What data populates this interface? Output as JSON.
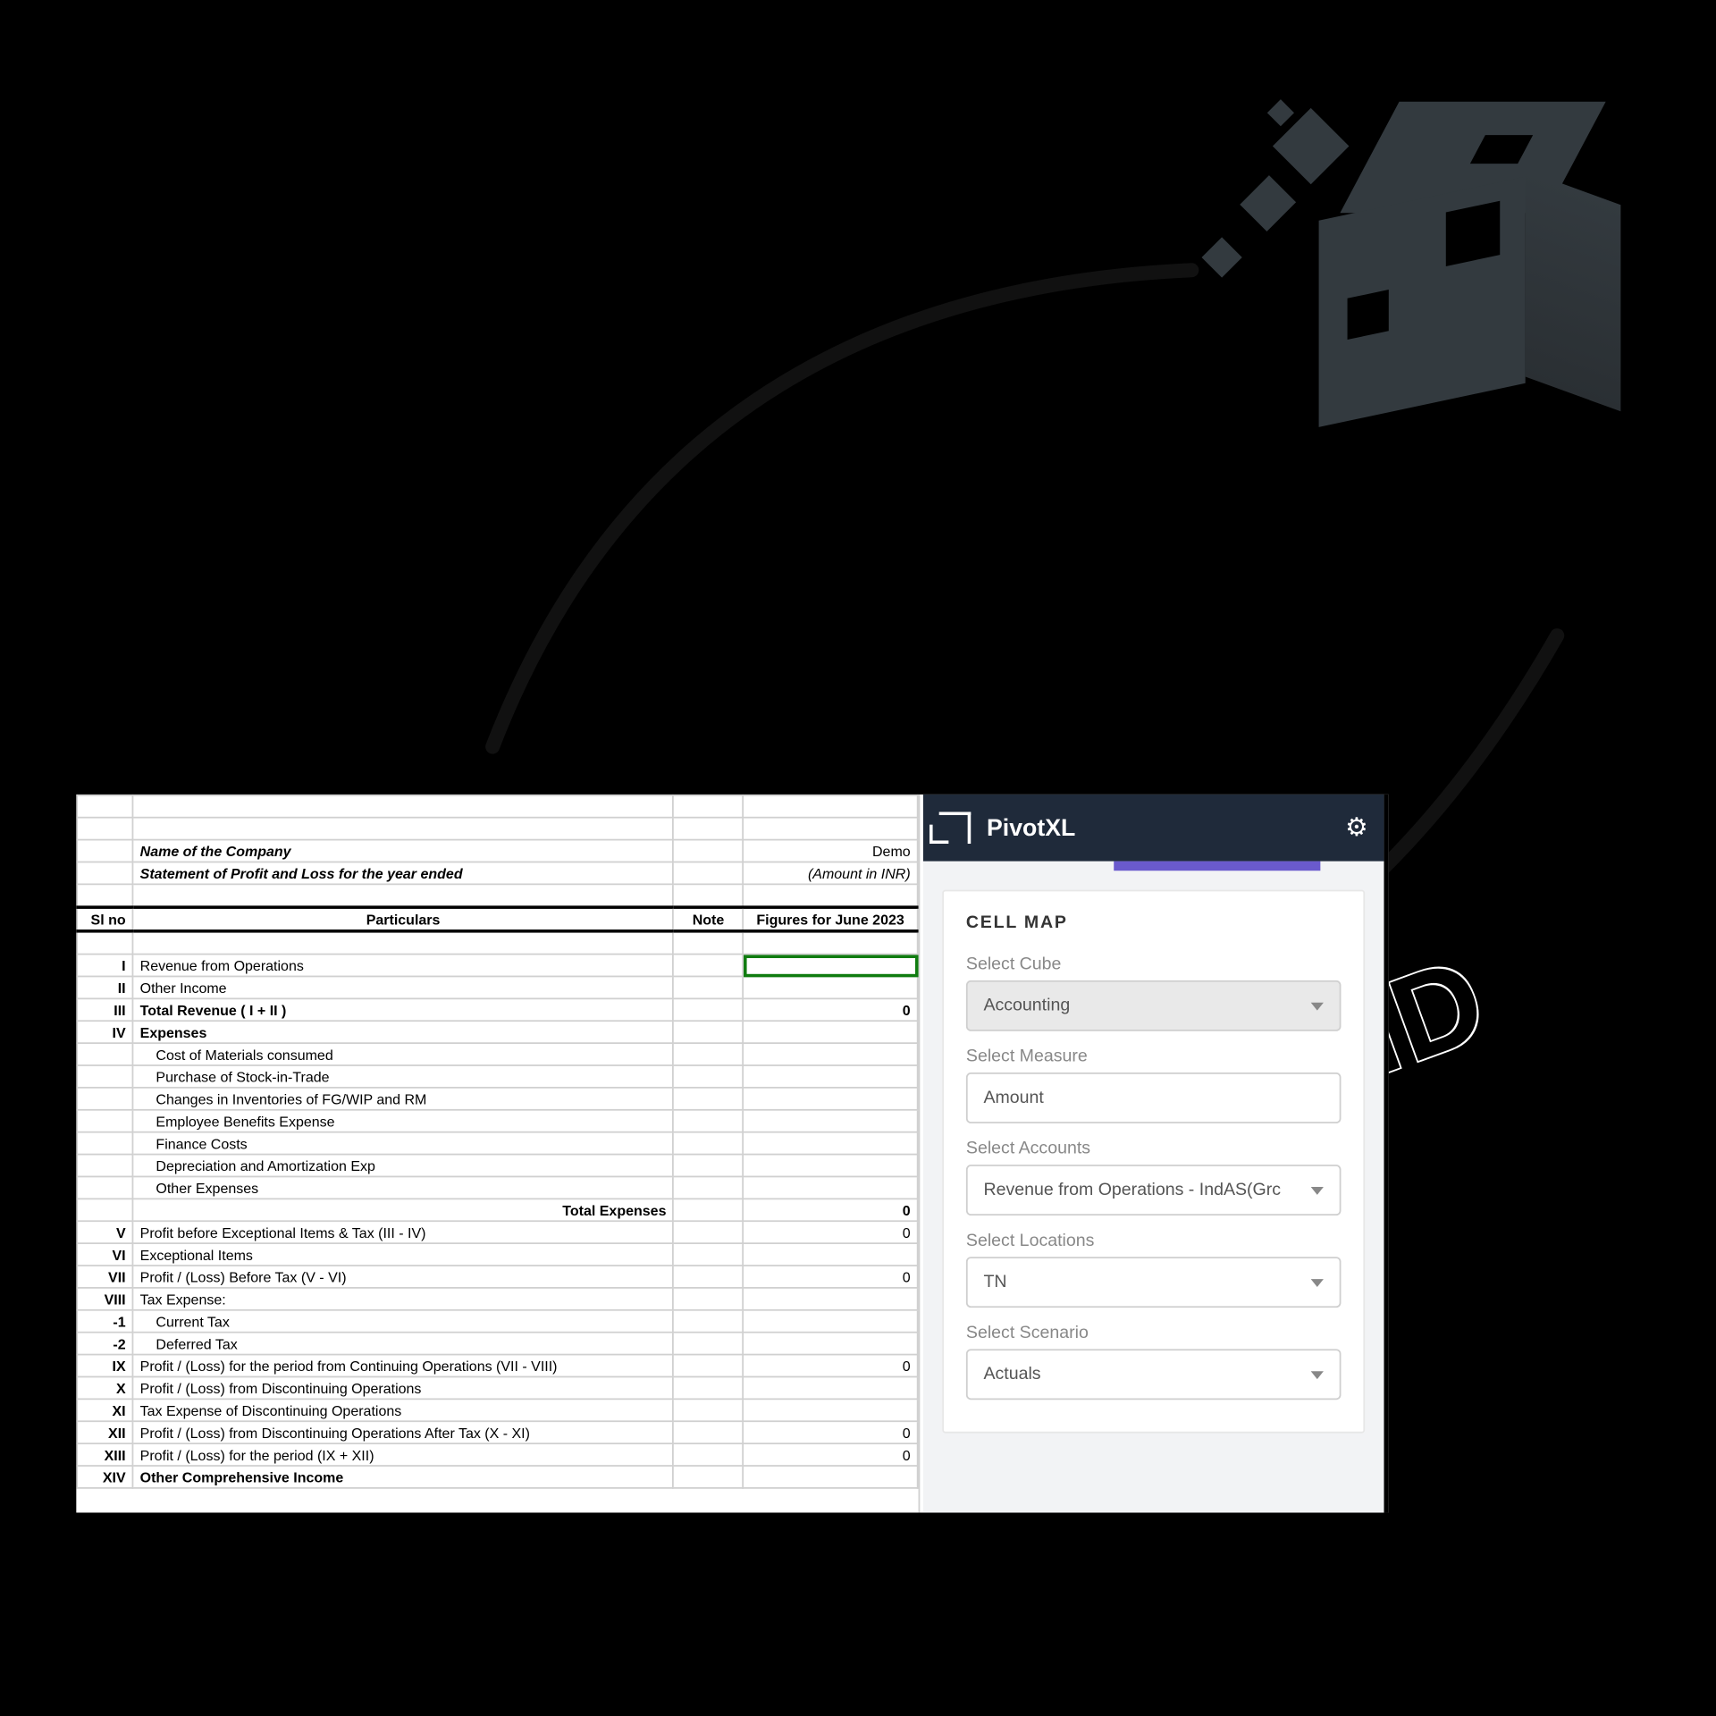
{
  "overlay": {
    "send_text": "SEND"
  },
  "spreadsheet": {
    "meta": {
      "name_label": "Name of the Company",
      "name_value": "Demo",
      "statement_label": "Statement of Profit and Loss for the year ended",
      "amount_label": "(Amount in INR)"
    },
    "headers": {
      "slno": "Sl no",
      "particulars": "Particulars",
      "note": "Note",
      "figures": "Figures for June 2023"
    },
    "rows": [
      {
        "sl": "I",
        "label": "Revenue from Operations",
        "fig": "",
        "bold": false,
        "indent": false,
        "selected": true
      },
      {
        "sl": "II",
        "label": "Other Income",
        "fig": "",
        "bold": false,
        "indent": false
      },
      {
        "sl": "III",
        "label": "Total Revenue ( I + II )",
        "fig": "0",
        "bold": true,
        "indent": false
      },
      {
        "sl": "IV",
        "label": "Expenses",
        "fig": "",
        "bold": true,
        "indent": false
      },
      {
        "sl": "",
        "label": "Cost of Materials consumed",
        "fig": "",
        "bold": false,
        "indent": true
      },
      {
        "sl": "",
        "label": "Purchase of Stock-in-Trade",
        "fig": "",
        "bold": false,
        "indent": true
      },
      {
        "sl": "",
        "label": "Changes in Inventories of FG/WIP and RM",
        "fig": "",
        "bold": false,
        "indent": true
      },
      {
        "sl": "",
        "label": "Employee Benefits Expense",
        "fig": "",
        "bold": false,
        "indent": true
      },
      {
        "sl": "",
        "label": "Finance Costs",
        "fig": "",
        "bold": false,
        "indent": true
      },
      {
        "sl": "",
        "label": "Depreciation and Amortization Exp",
        "fig": "",
        "bold": false,
        "indent": true
      },
      {
        "sl": "",
        "label": "Other Expenses",
        "fig": "",
        "bold": false,
        "indent": true
      },
      {
        "sl": "",
        "label": "Total Expenses",
        "fig": "0",
        "bold": true,
        "indent": false,
        "label_right": true
      },
      {
        "sl": "V",
        "label": "Profit before Exceptional Items & Tax (III - IV)",
        "fig": "0",
        "bold": false,
        "indent": false
      },
      {
        "sl": "VI",
        "label": "Exceptional Items",
        "fig": "",
        "bold": false,
        "indent": false
      },
      {
        "sl": "VII",
        "label": "Profit / (Loss) Before Tax (V - VI)",
        "fig": "0",
        "bold": false,
        "indent": false
      },
      {
        "sl": "VIII",
        "label": "Tax Expense:",
        "fig": "",
        "bold": false,
        "indent": false
      },
      {
        "sl": "-1",
        "label": "Current Tax",
        "fig": "",
        "bold": false,
        "indent": true
      },
      {
        "sl": "-2",
        "label": "Deferred Tax",
        "fig": "",
        "bold": false,
        "indent": true
      },
      {
        "sl": "IX",
        "label": "Profit / (Loss) for the period from Continuing Operations (VII - VIII)",
        "fig": "0",
        "bold": false,
        "indent": false
      },
      {
        "sl": "X",
        "label": "Profit / (Loss) from Discontinuing Operations",
        "fig": "",
        "bold": false,
        "indent": false
      },
      {
        "sl": "XI",
        "label": "Tax Expense of Discontinuing Operations",
        "fig": "",
        "bold": false,
        "indent": false
      },
      {
        "sl": "XII",
        "label": "Profit / (Loss)  from Discontinuing Operations After Tax (X - XI)",
        "fig": "0",
        "bold": false,
        "indent": false
      },
      {
        "sl": "XIII",
        "label": "Profit / (Loss) for the period (IX + XII)",
        "fig": "0",
        "bold": false,
        "indent": false
      },
      {
        "sl": "XIV",
        "label": "Other Comprehensive Income",
        "fig": "",
        "bold": true,
        "indent": false
      }
    ]
  },
  "panel": {
    "brand": "PivotXL",
    "section_title": "CELL MAP",
    "fields": {
      "cube": {
        "label": "Select Cube",
        "value": "Accounting",
        "greyed": true
      },
      "measure": {
        "label": "Select Measure",
        "value": "Amount",
        "greyed": false
      },
      "accounts": {
        "label": "Select Accounts",
        "value": "Revenue from Operations - IndAS(Grc",
        "greyed": false
      },
      "locations": {
        "label": "Select Locations",
        "value": "TN",
        "greyed": false
      },
      "scenario": {
        "label": "Select Scenario",
        "value": "Actuals",
        "greyed": false
      }
    }
  }
}
